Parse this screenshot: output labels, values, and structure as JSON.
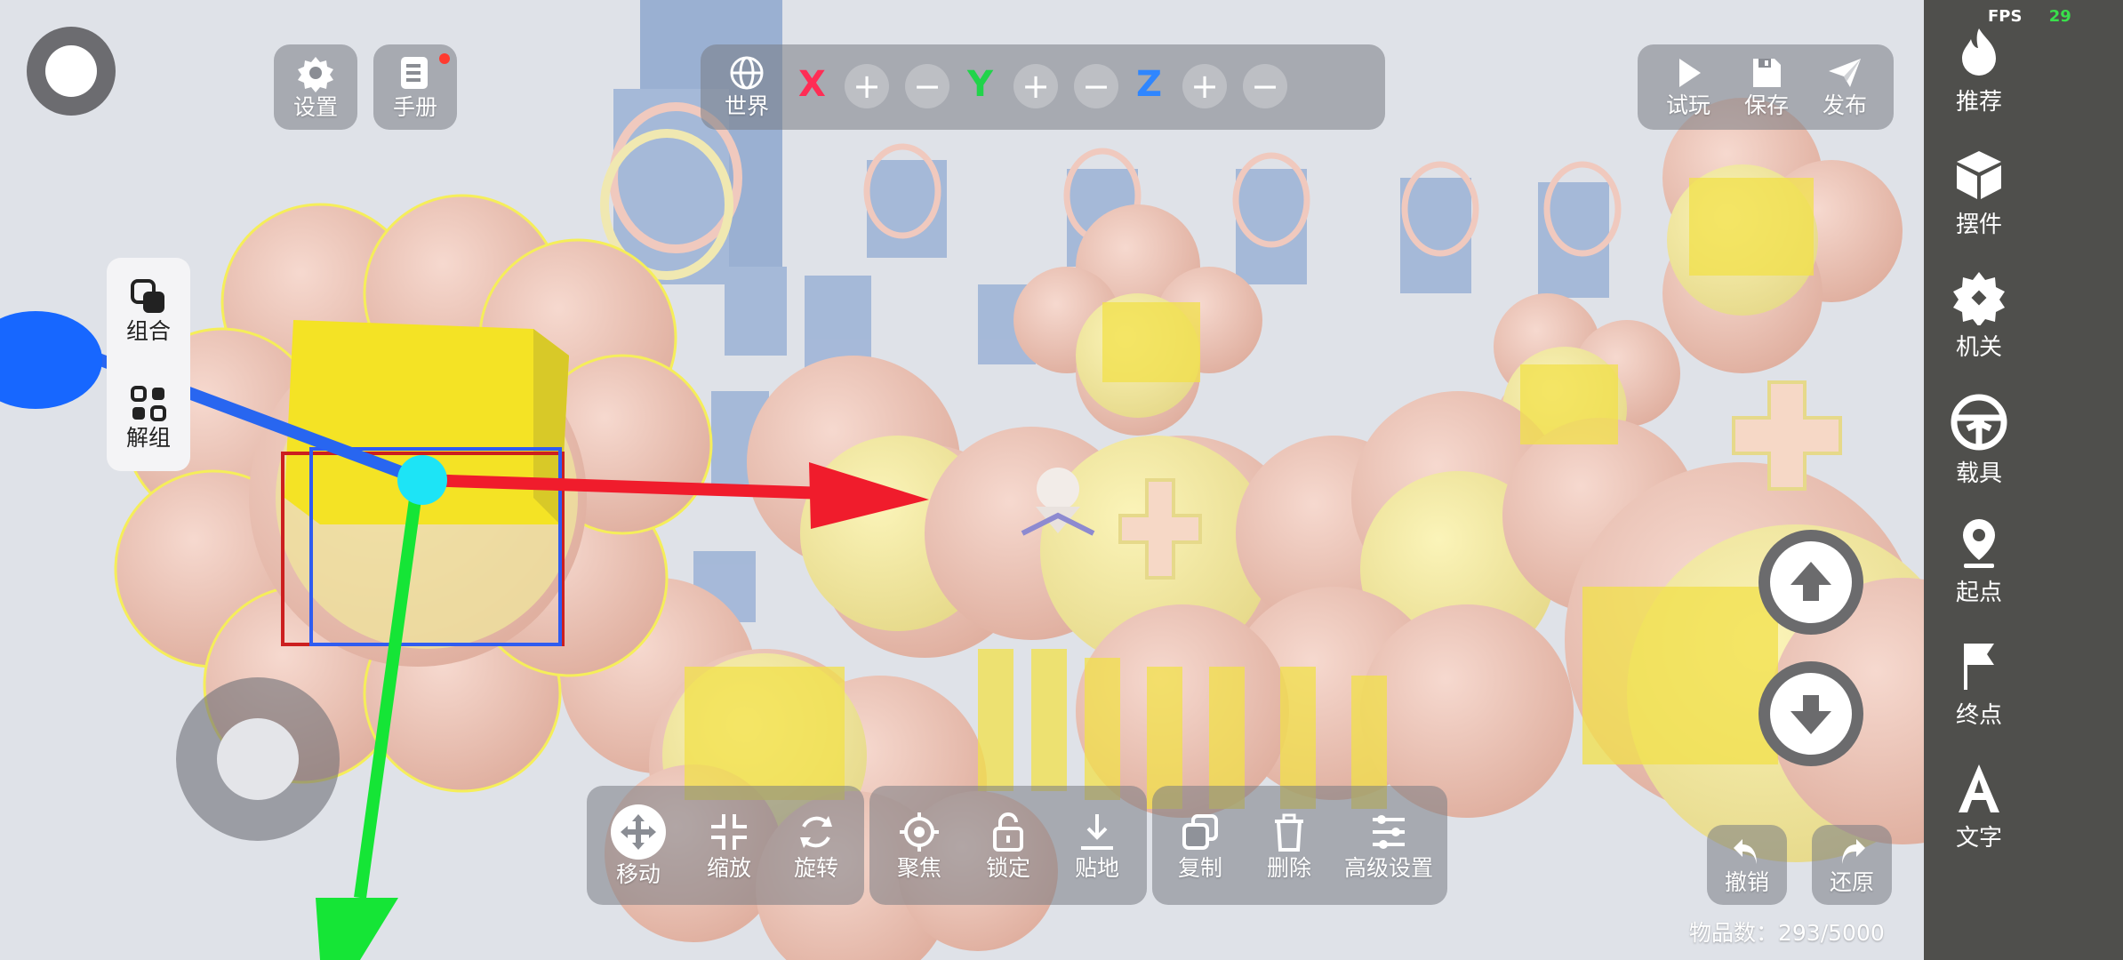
{
  "fps": {
    "label": "FPS",
    "value": "29"
  },
  "top_left": {
    "settings": "设置",
    "manual": "手册"
  },
  "axis_bar": {
    "world": "世界",
    "x": "X",
    "y": "Y",
    "z": "Z",
    "plus": "+",
    "minus": "−"
  },
  "top_right": {
    "play": "试玩",
    "save": "保存",
    "publish": "发布"
  },
  "group_panel": {
    "group": "组合",
    "ungroup": "解组"
  },
  "sidebar": {
    "recommend": "推荐",
    "parts": "摆件",
    "mechanism": "机关",
    "vehicle": "载具",
    "start": "起点",
    "end": "终点",
    "text": "文字"
  },
  "bottom_toolbar": {
    "move": "移动",
    "scale": "缩放",
    "rotate": "旋转",
    "focus": "聚焦",
    "lock": "锁定",
    "ground": "贴地",
    "copy": "复制",
    "delete": "删除",
    "advanced": "高级设置"
  },
  "undo_redo": {
    "undo": "撤销",
    "redo": "还原"
  },
  "item_count": "物品数：293/5000",
  "colors": {
    "sidebar": "#4f4f4c",
    "x_axis": "#ff2d55",
    "y_axis": "#21d44a",
    "z_axis": "#2f86ff",
    "fps_value": "#39e04b",
    "notification_dot": "#ff3b30"
  }
}
